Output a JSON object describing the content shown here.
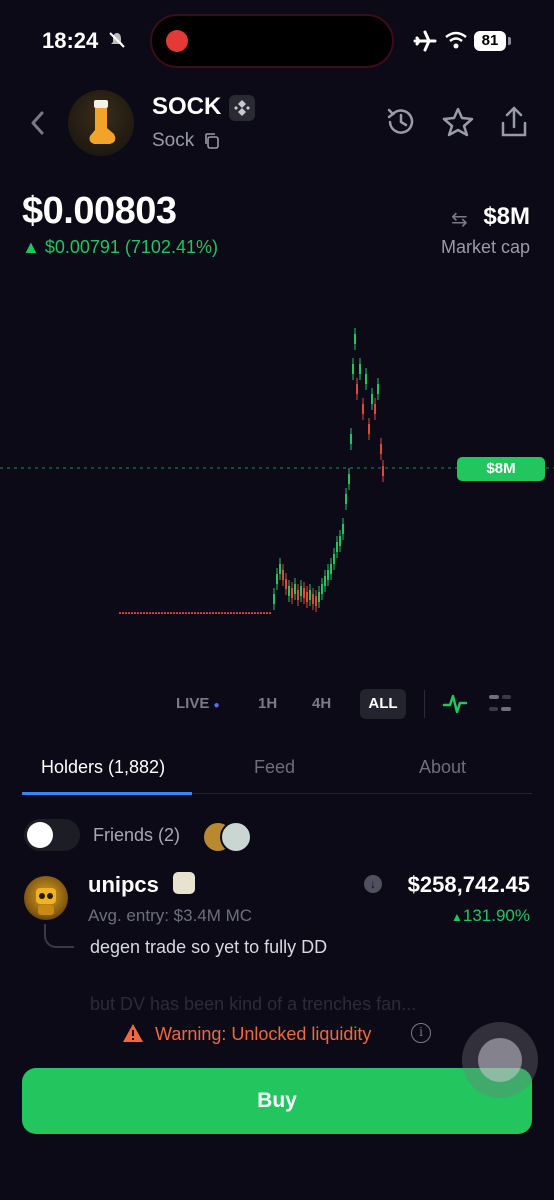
{
  "status_bar": {
    "time": "18:24",
    "battery": "81"
  },
  "token": {
    "symbol": "SOCK",
    "name": "Sock"
  },
  "price": {
    "value": "$0.00803",
    "change": "$0.00791 (7102.41%)"
  },
  "market_cap": {
    "value": "$8M",
    "label": "Market cap",
    "chart_tag": "$8M"
  },
  "timeframes": [
    "LIVE",
    "1H",
    "4H",
    "ALL"
  ],
  "tabs": {
    "holders": "Holders (1,882)",
    "feed": "Feed",
    "about": "About"
  },
  "friends": {
    "label": "Friends (2)"
  },
  "holder": {
    "name": "unipcs",
    "entry": "Avg. entry: $3.4M MC",
    "value": "$258,742.45",
    "pnl": "131.90%",
    "comment": "degen trade so yet to fully DD",
    "next_comment_faded": "but DV has been kind of a trenches fan..."
  },
  "warning": {
    "text": "Warning: Unlocked liquidity"
  },
  "buy": {
    "label": "Buy"
  },
  "colors": {
    "green": "#22c55e",
    "warning": "#f2683c",
    "background": "#0b0a16"
  }
}
